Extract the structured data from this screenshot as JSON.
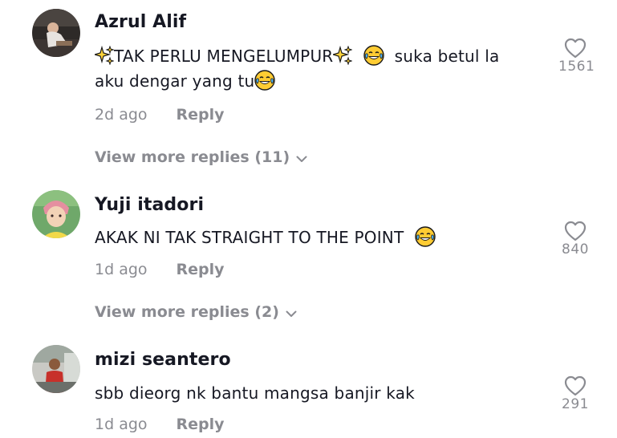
{
  "comments": [
    {
      "username": "Azrul Alif",
      "text_part1": "TAK PERLU MENGELUMPUR",
      "text_part2": "suka betul la",
      "text_line2": "aku dengar yang tu",
      "time": "2d ago",
      "reply_label": "Reply",
      "likes": "1561",
      "view_more": "View more replies (11)"
    },
    {
      "username": "Yuji itadori",
      "text": "AKAK NI TAK STRAIGHT TO THE POINT",
      "time": "1d ago",
      "reply_label": "Reply",
      "likes": "840",
      "view_more": "View more replies (2)"
    },
    {
      "username": "mizi seantero",
      "text": "sbb dieorg nk bantu mangsa banjir kak",
      "time": "1d ago",
      "reply_label": "Reply",
      "likes": "291"
    }
  ],
  "icons": {
    "like": "heart-outline-icon",
    "expand": "chevron-down-icon",
    "emoji_laugh": "face-with-tears-of-joy",
    "emoji_sparkles": "sparkles"
  },
  "colors": {
    "primary_text": "#161823",
    "secondary_text": "#8a8b91",
    "heart_stroke": "#8a8b91",
    "emoji_yellow": "#ffcc33",
    "sparkle_yellow": "#ffd43b"
  }
}
